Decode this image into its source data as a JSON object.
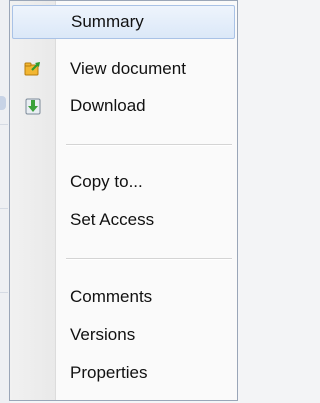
{
  "menu": {
    "items": [
      {
        "label": "Summary",
        "icon": "none",
        "highlighted": true
      },
      {
        "label": "View document",
        "icon": "view-document-icon"
      },
      {
        "label": "Download",
        "icon": "download-icon"
      },
      {
        "label": "Copy to...",
        "icon": "none"
      },
      {
        "label": "Set Access",
        "icon": "none"
      },
      {
        "label": "Comments",
        "icon": "none"
      },
      {
        "label": "Versions",
        "icon": "none"
      },
      {
        "label": "Properties",
        "icon": "none"
      }
    ]
  },
  "colors": {
    "highlight_border": "#a9c2e6",
    "highlight_fill": "#dbe8f8",
    "menu_border": "#9aa6b8",
    "download_arrow": "#3aa23a",
    "view_doc_folder": "#e8a418"
  }
}
